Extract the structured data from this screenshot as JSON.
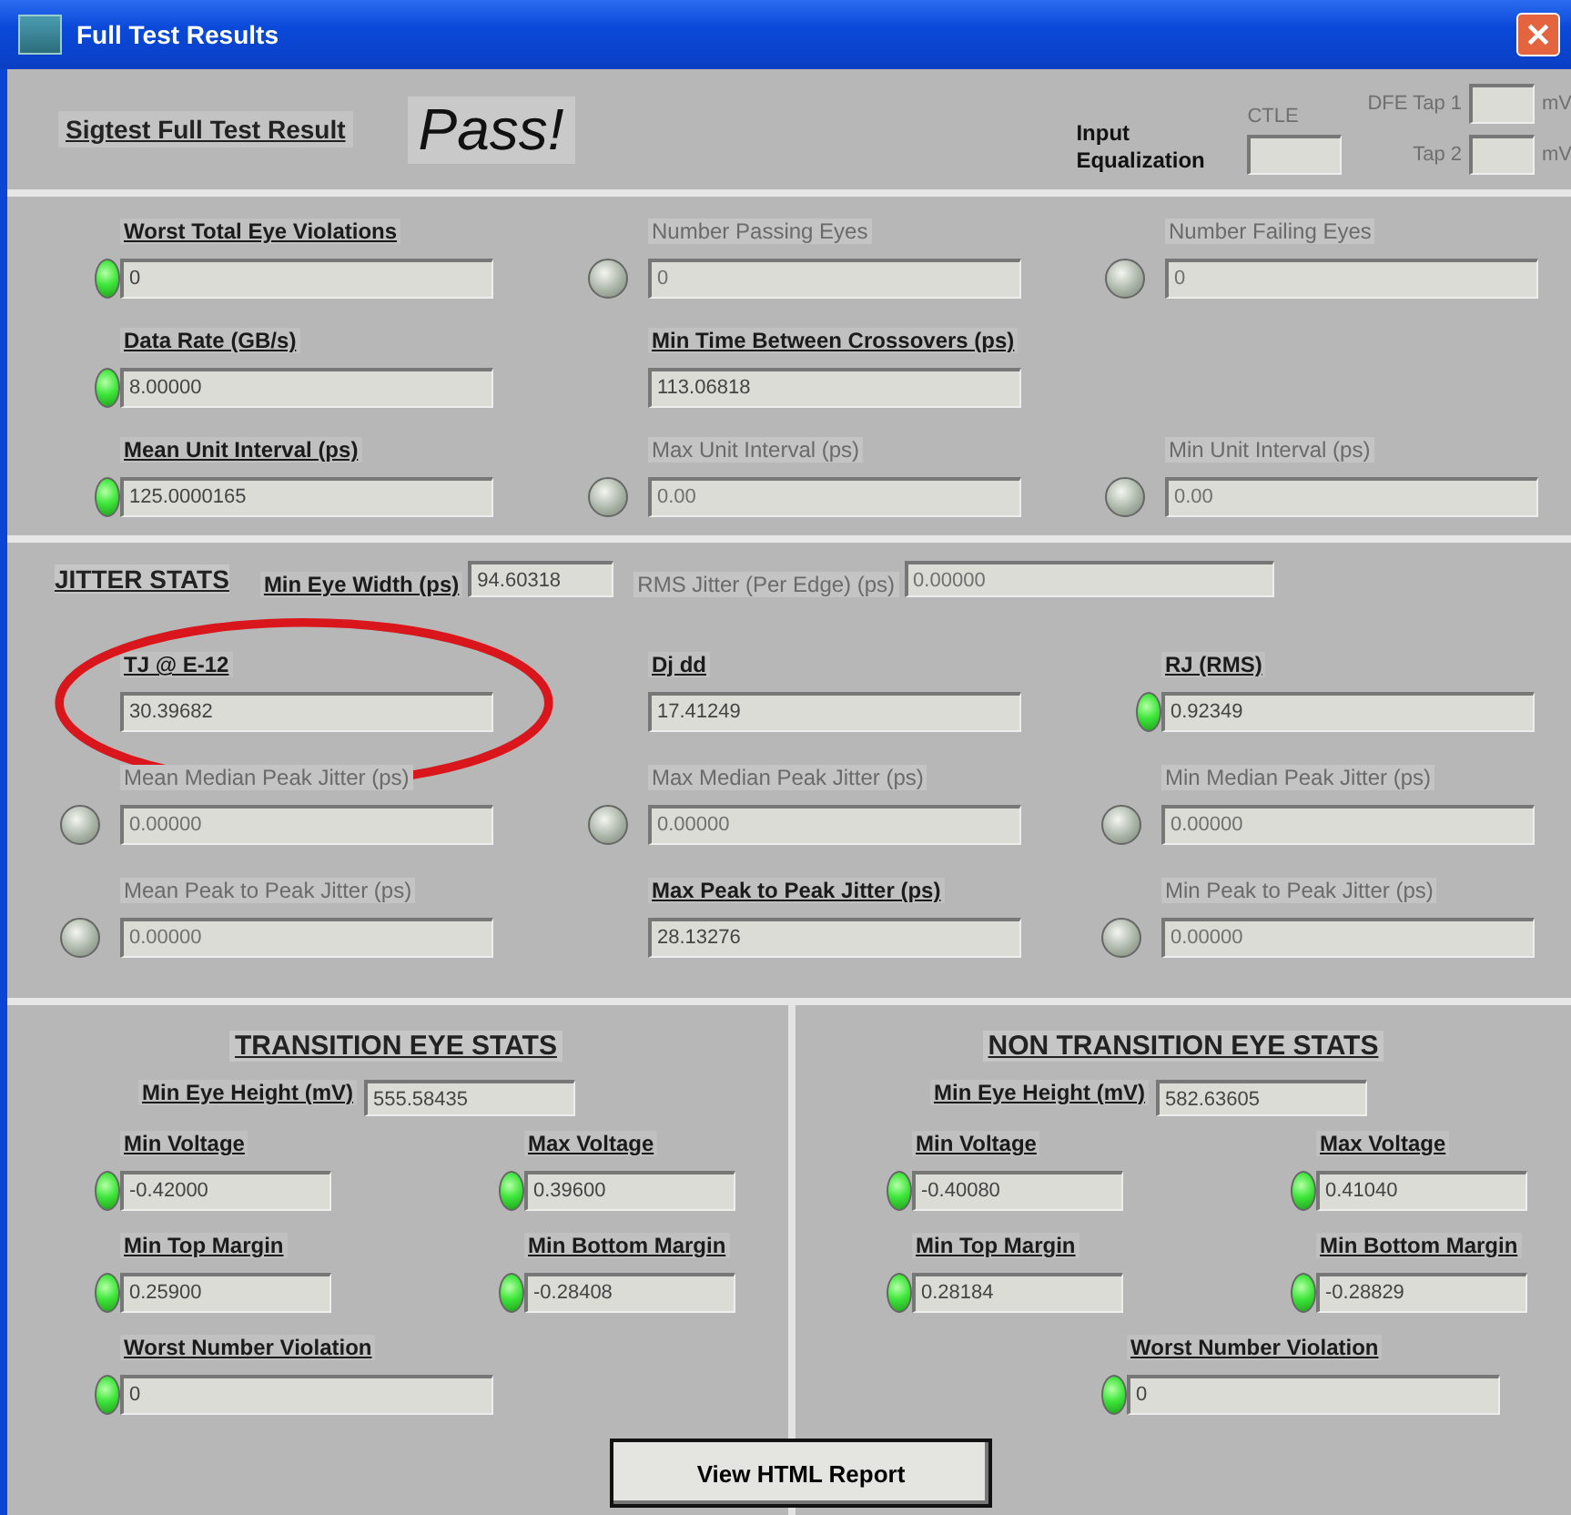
{
  "window": {
    "title": "Full Test Results"
  },
  "header": {
    "title": "Sigtest Full Test Result",
    "result": "Pass!",
    "equalization": {
      "label": "Input Equalization",
      "controls": [
        {
          "label": "CTLE",
          "enabled": false
        },
        {
          "label": "DFE Tap 1",
          "enabled": false,
          "unit": "mV"
        },
        {
          "label": "Tap 2",
          "enabled": false,
          "unit": "mV"
        }
      ]
    }
  },
  "summary": {
    "metrics": [
      {
        "label": "Worst Total Eye Violations",
        "value": "0",
        "enabled": true,
        "lit": true
      },
      {
        "label": "Number Passing Eyes",
        "value": "0",
        "enabled": false,
        "lit": false
      },
      {
        "label": "Number Failing Eyes",
        "value": "0",
        "enabled": false,
        "lit": false
      },
      {
        "label": "Data Rate (GB/s)",
        "value": "8.00000",
        "enabled": true,
        "lit": true
      },
      {
        "label": "Min Time Between Crossovers (ps)",
        "value": "113.06818",
        "enabled": true
      },
      {
        "kind": "empty"
      },
      {
        "label": "Mean Unit Interval (ps)",
        "value": "125.0000165",
        "enabled": true,
        "lit": true
      },
      {
        "label": "Max Unit Interval (ps)",
        "value": "0.00",
        "enabled": false,
        "lit": false
      },
      {
        "label": "Min Unit Interval (ps)",
        "value": "0.00",
        "enabled": false,
        "lit": false
      }
    ]
  },
  "jitter": {
    "title": "JITTER STATS",
    "inline": [
      {
        "label": "Min Eye Width (ps)",
        "value": "94.60318",
        "enabled": true
      },
      {
        "label": "RMS Jitter (Per Edge) (ps)",
        "value": "0.00000",
        "enabled": false
      }
    ],
    "metrics": [
      {
        "label": "TJ @ E-12",
        "value": "30.39682",
        "enabled": true,
        "circled": true
      },
      {
        "label": "Dj dd",
        "value": "17.41249",
        "enabled": true
      },
      {
        "label": "RJ (RMS)",
        "value": "0.92349",
        "enabled": true,
        "lit": true
      },
      {
        "label": "Mean Median Peak Jitter (ps)",
        "value": "0.00000",
        "enabled": false,
        "lit": false
      },
      {
        "label": "Max Median Peak Jitter (ps)",
        "value": "0.00000",
        "enabled": false,
        "lit": false
      },
      {
        "label": "Min Median Peak Jitter (ps)",
        "value": "0.00000",
        "enabled": false,
        "lit": false
      },
      {
        "label": "Mean Peak to Peak Jitter (ps)",
        "value": "0.00000",
        "enabled": false,
        "lit": false
      },
      {
        "label": "Max Peak to Peak Jitter (ps)",
        "value": "28.13276",
        "enabled": true
      },
      {
        "label": "Min Peak to Peak Jitter (ps)",
        "value": "0.00000",
        "enabled": false,
        "lit": false
      }
    ]
  },
  "eye_panels": [
    {
      "title": "TRANSITION EYE STATS",
      "eye_height": {
        "label": "Min Eye Height (mV)",
        "value": "555.58435"
      },
      "metrics": [
        {
          "label": "Min Voltage",
          "value": "-0.42000",
          "enabled": true,
          "lit": true
        },
        {
          "label": "Max Voltage",
          "value": "0.39600",
          "enabled": true,
          "lit": true
        },
        {
          "label": "Min Top Margin",
          "value": "0.25900",
          "enabled": true,
          "lit": true
        },
        {
          "label": "Min Bottom Margin",
          "value": "-0.28408",
          "enabled": true,
          "lit": true
        }
      ],
      "worst": {
        "label": "Worst Number Violation",
        "value": "0",
        "enabled": true,
        "lit": true
      }
    },
    {
      "title": "NON TRANSITION EYE STATS",
      "eye_height": {
        "label": "Min Eye Height (mV)",
        "value": "582.63605"
      },
      "metrics": [
        {
          "label": "Min Voltage",
          "value": "-0.40080",
          "enabled": true,
          "lit": true
        },
        {
          "label": "Max Voltage",
          "value": "0.41040",
          "enabled": true,
          "lit": true
        },
        {
          "label": "Min Top Margin",
          "value": "0.28184",
          "enabled": true,
          "lit": true
        },
        {
          "label": "Min Bottom Margin",
          "value": "-0.28829",
          "enabled": true,
          "lit": true
        }
      ],
      "worst": {
        "label": "Worst Number Violation",
        "value": "0",
        "enabled": true,
        "lit": true
      }
    }
  ],
  "report_button": "View HTML Report"
}
